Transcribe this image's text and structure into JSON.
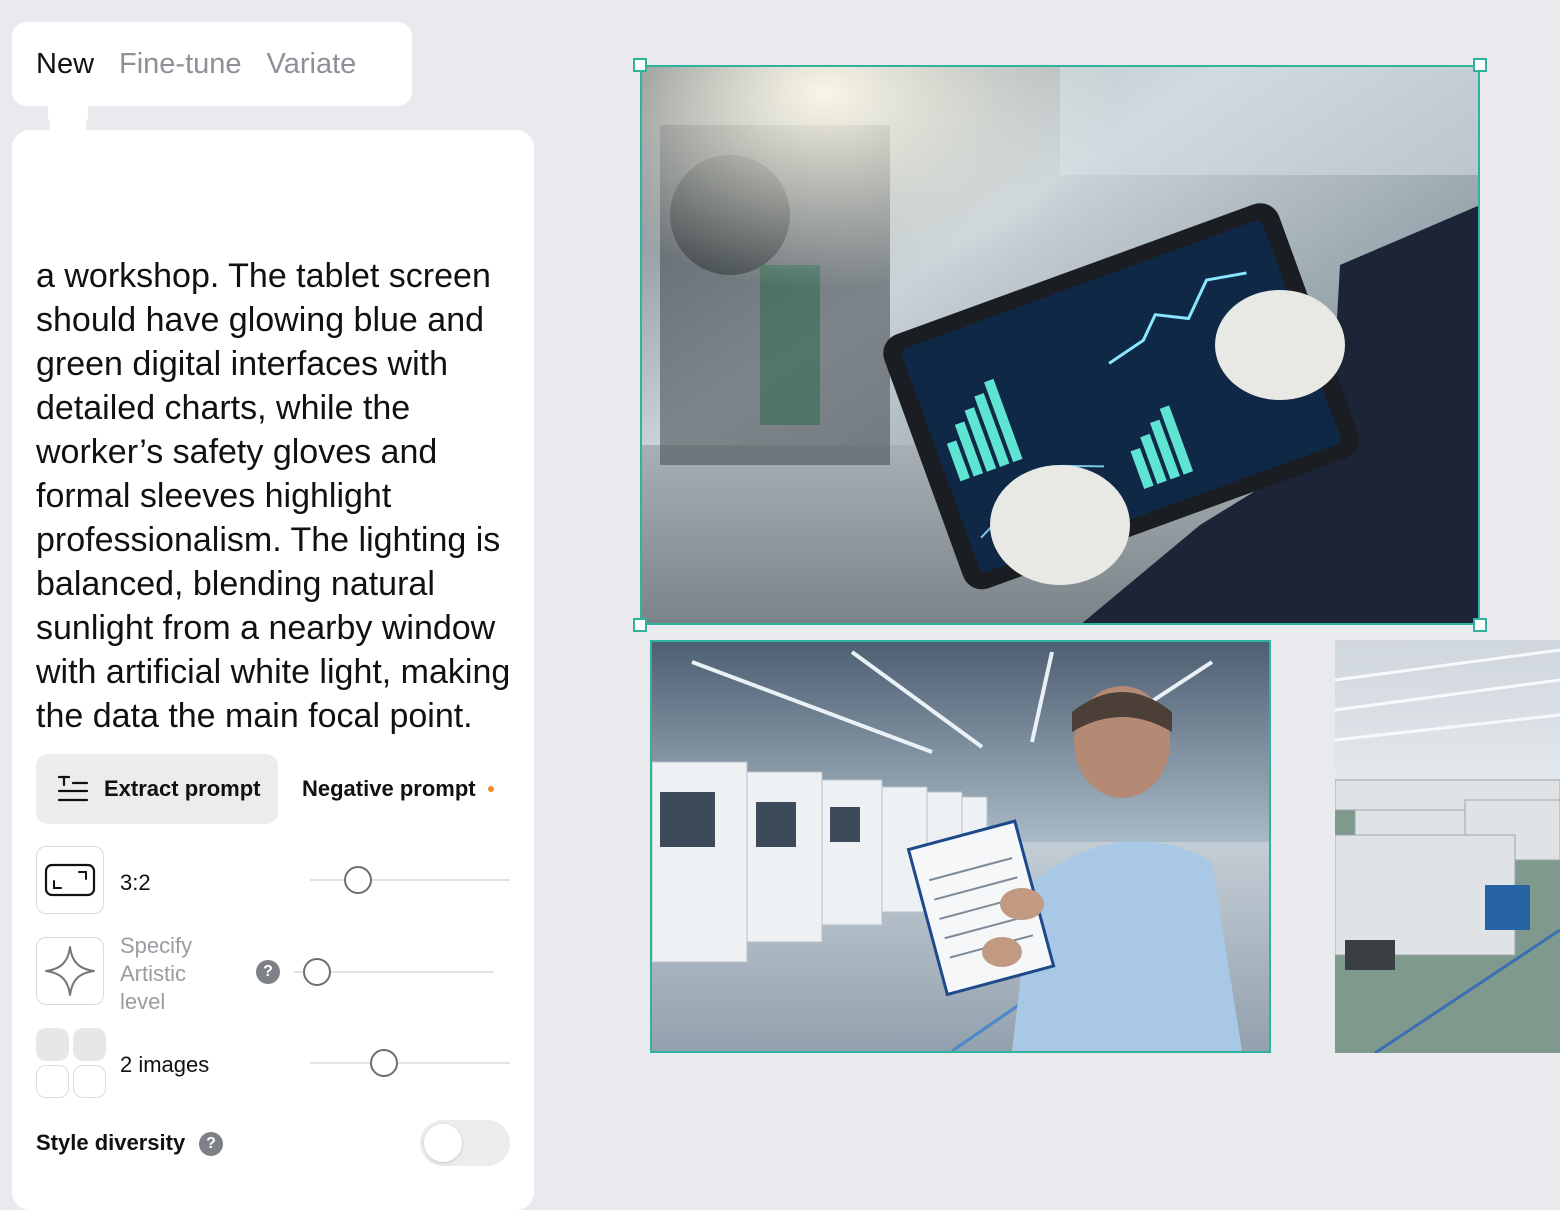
{
  "tabs": [
    {
      "label": "New",
      "active": true
    },
    {
      "label": "Fine-tune",
      "active": false
    },
    {
      "label": "Variate",
      "active": false
    }
  ],
  "prompt": {
    "text": "a workshop. The tablet screen should have glowing blue and green digital interfaces with detailed charts, while the worker’s safety gloves and formal sleeves highlight professionalism. The lighting is balanced, blending natural sunlight from a nearby window with artificial white light, making the data the main focal point."
  },
  "actions": {
    "extract_label": "Extract prompt",
    "negative_label": "Negative prompt"
  },
  "settings": {
    "aspect": {
      "label": "3:2",
      "icon": "aspect-ratio-icon",
      "slider_value": 0.2
    },
    "artistic": {
      "label": "Specify\nArtistic\nlevel",
      "help": "?",
      "icon": "sparkle-icon",
      "slider_value": 0.05
    },
    "images": {
      "label": "2 images",
      "icon": "grid-icon",
      "slider_value": 0.35
    },
    "style_diversity": {
      "label": "Style diversity",
      "help": "?",
      "enabled": false
    }
  },
  "colors": {
    "accent": "#2fb39c",
    "dot": "#f08a2c"
  },
  "canvas": {
    "images": [
      {
        "name": "tablet-factory-image",
        "selected": true
      },
      {
        "name": "clipboard-worker-image",
        "selected": false
      },
      {
        "name": "factory-floor-image",
        "selected": false
      }
    ]
  }
}
